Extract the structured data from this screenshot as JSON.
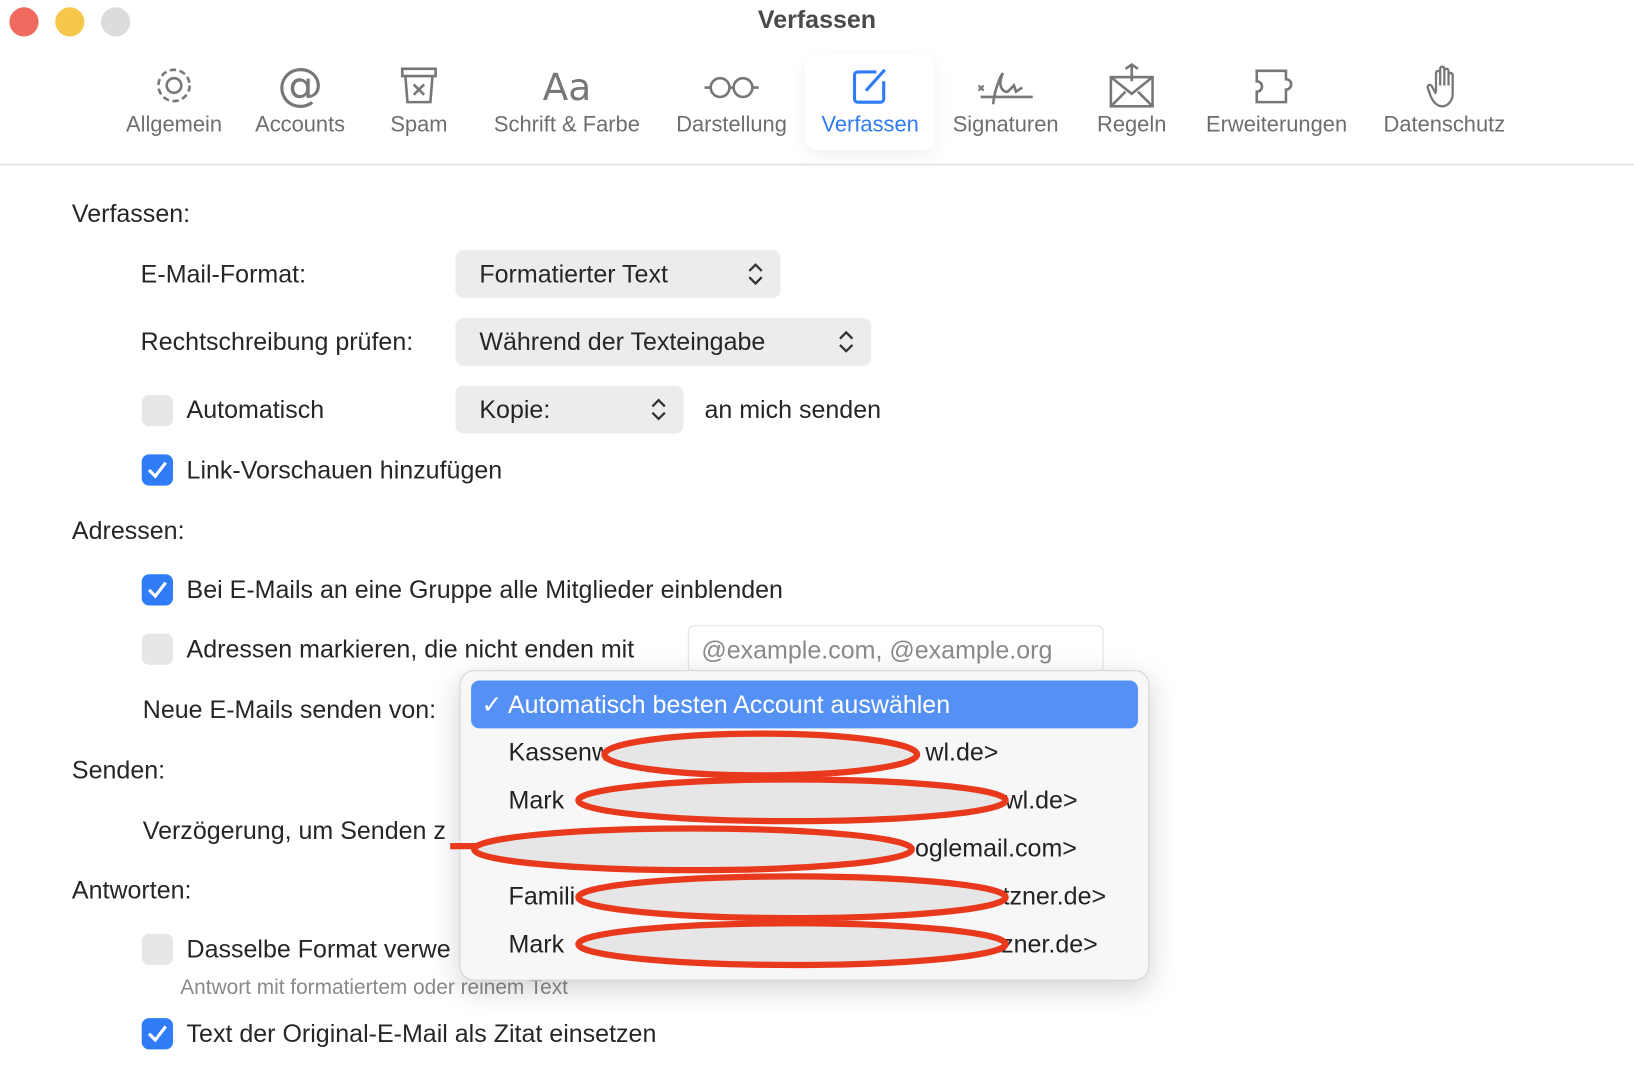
{
  "window": {
    "title": "Verfassen"
  },
  "toolbar": {
    "items": [
      {
        "label": "Allgemein",
        "icon": "gear-icon"
      },
      {
        "label": "Accounts",
        "icon": "at-icon"
      },
      {
        "label": "Spam",
        "icon": "junk-bin-icon"
      },
      {
        "label": "Schrift & Farbe",
        "icon": "font-icon"
      },
      {
        "label": "Darstellung",
        "icon": "glasses-icon"
      },
      {
        "label": "Verfassen",
        "icon": "compose-icon",
        "active": true
      },
      {
        "label": "Signaturen",
        "icon": "signature-icon"
      },
      {
        "label": "Regeln",
        "icon": "rules-envelope-icon"
      },
      {
        "label": "Erweiterungen",
        "icon": "puzzle-icon"
      },
      {
        "label": "Datenschutz",
        "icon": "hand-icon"
      }
    ]
  },
  "colors": {
    "accent": "#2f7cf6",
    "menu_highlight": "#5591f5",
    "redaction": "#e8391d"
  },
  "compose": {
    "section": "Verfassen:",
    "format_label": "E-Mail-Format:",
    "format_value": "Formatierter Text",
    "spell_label": "Rechtschreibung prüfen:",
    "spell_value": "Während der Texteingabe",
    "auto_label": "Automatisch",
    "auto_checked": false,
    "copy_value": "Kopie:",
    "copy_suffix": "an mich senden",
    "link_preview_label": "Link-Vorschauen hinzufügen",
    "link_preview_checked": true
  },
  "addresses": {
    "section": "Adressen:",
    "group_label": "Bei E-Mails an eine Gruppe alle Mitglieder einblenden",
    "group_checked": true,
    "mark_label": "Adressen markieren, die nicht enden mit",
    "mark_checked": false,
    "mark_placeholder": "@example.com, @example.org",
    "send_from_label": "Neue E-Mails senden von:"
  },
  "send": {
    "section": "Senden:",
    "delay_label": "Verzögerung, um Senden z"
  },
  "reply": {
    "section": "Antworten:",
    "same_format_label": "Dasselbe Format verwe",
    "same_format_checked": false,
    "same_format_hint": "Antwort mit formatiertem oder reinem Text",
    "quote_label": "Text der Original-E-Mail als Zitat einsetzen",
    "quote_checked": true
  },
  "menu": {
    "selected": "✓ Automatisch besten Account auswählen",
    "items": [
      {
        "prefix": "Kassenw",
        "suffix": "wl.de>"
      },
      {
        "prefix": "Mark",
        "suffix": "wl.de>"
      },
      {
        "prefix": "",
        "suffix": "oglemail.com>"
      },
      {
        "prefix": "Famili",
        "suffix": "tzner.de>"
      },
      {
        "prefix": "Mark",
        "suffix": "tzner.de>"
      }
    ]
  }
}
